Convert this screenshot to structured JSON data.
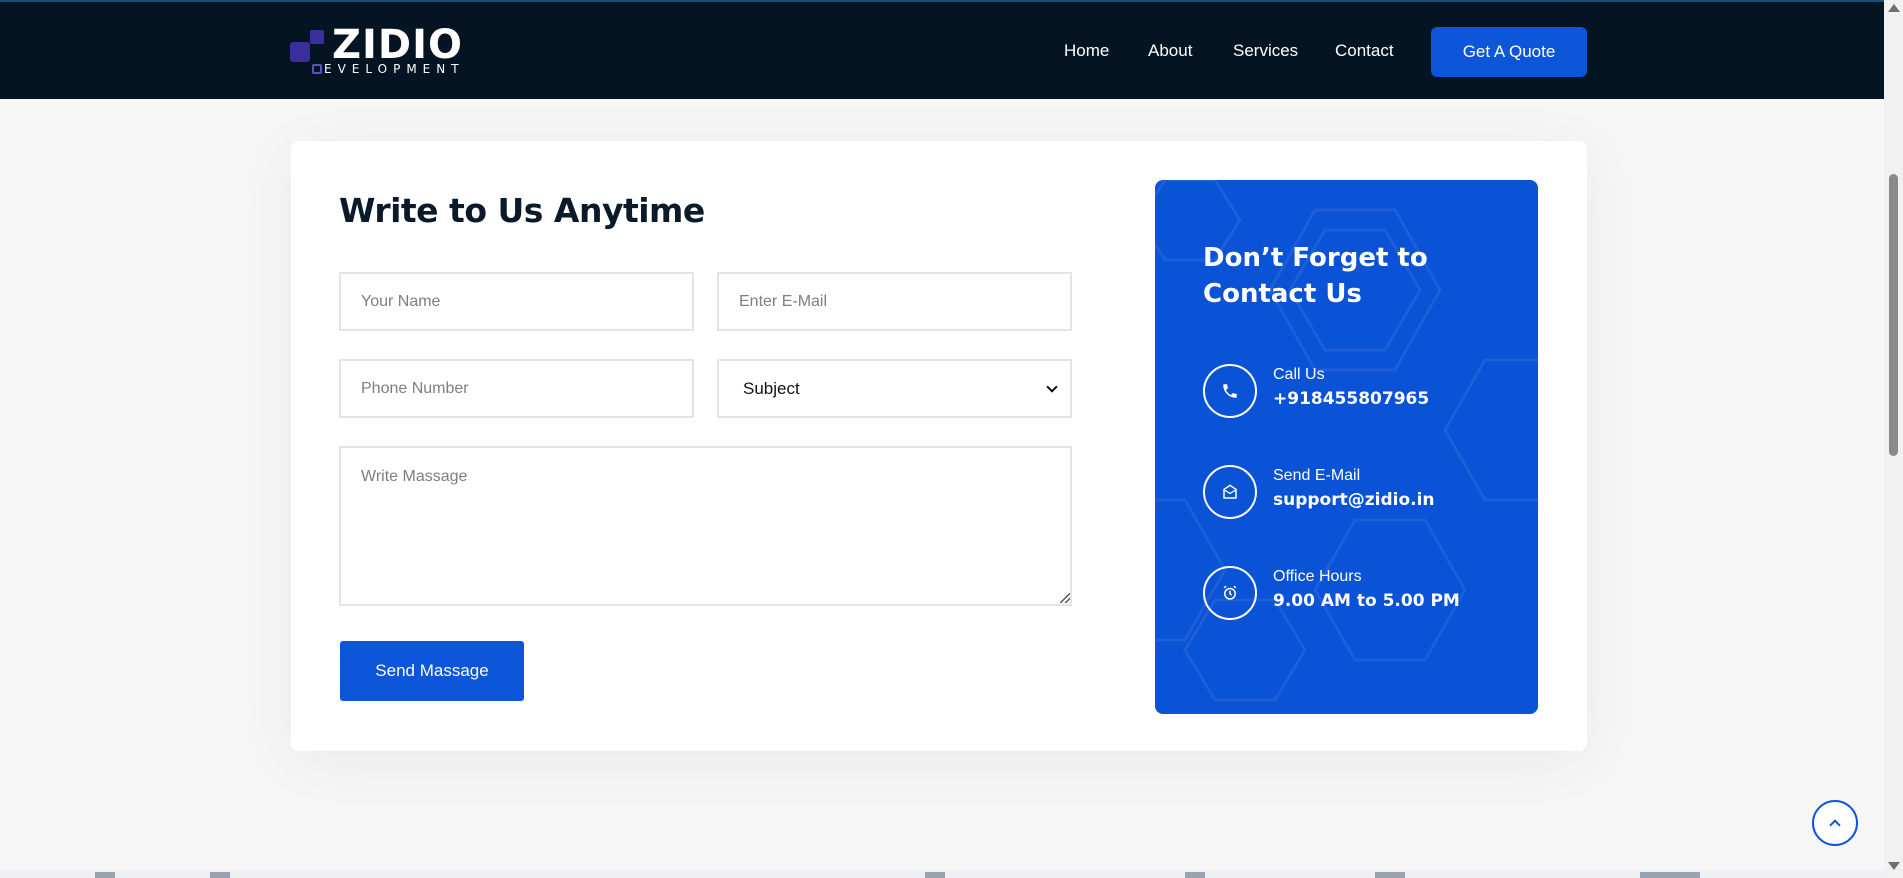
{
  "header": {
    "logo_text": "ZIDIO",
    "logo_sub": "EVELOPMENT",
    "nav": [
      {
        "label": "Home"
      },
      {
        "label": "About"
      },
      {
        "label": "Services"
      },
      {
        "label": "Contact"
      }
    ],
    "cta_label": "Get A Quote"
  },
  "form": {
    "title": "Write to Us Anytime",
    "name_placeholder": "Your Name",
    "email_placeholder": "Enter E-Mail",
    "phone_placeholder": "Phone Number",
    "subject_selected": "Subject",
    "message_placeholder": "Write Massage",
    "submit_label": "Send Massage"
  },
  "contact": {
    "title": "Don’t Forget to Contact Us",
    "items": [
      {
        "label": "Call Us",
        "value": "+918455807965",
        "icon": "phone-icon"
      },
      {
        "label": "Send E-Mail",
        "value": "support@zidio.in",
        "icon": "mail-open-icon"
      },
      {
        "label": "Office Hours",
        "value": "9.00 AM to 5.00 PM",
        "icon": "alarm-clock-icon"
      }
    ]
  },
  "colors": {
    "header_bg": "#051423",
    "accent": "#0d55d9",
    "panel_bg": "#0a52d6",
    "page_bg": "#f6f6f7"
  },
  "icons": {
    "back_to_top": "chevron-up-icon"
  }
}
